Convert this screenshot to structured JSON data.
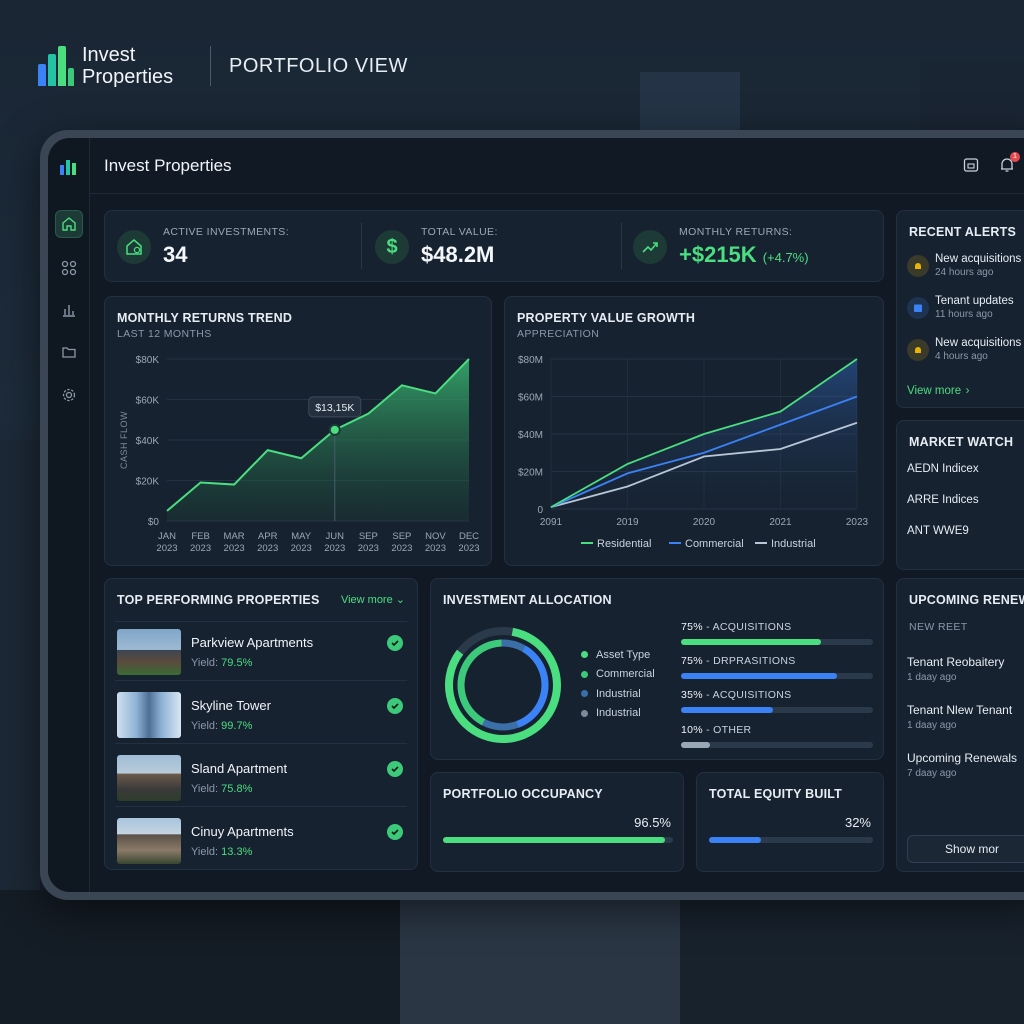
{
  "brand": {
    "title": "Invest Properties",
    "view": "PORTFOLIO VIEW"
  },
  "colors": {
    "accent_green": "#4ade80",
    "accent_blue": "#3b82f6",
    "muted": "#8a98a8",
    "bg_card": "#172230"
  },
  "topbar": {
    "title": "Invest Properties",
    "notification_count": "1"
  },
  "rail": {
    "icons": [
      "home-icon",
      "grid-icon",
      "bar-chart-icon",
      "folder-icon",
      "settings-icon"
    ]
  },
  "kpis": [
    {
      "label": "ACTIVE INVESTMENTS:",
      "value": "34",
      "icon": "house-icon"
    },
    {
      "label": "TOTAL VALUE:",
      "value": "$48.2M",
      "icon": "dollar-icon"
    },
    {
      "label": "MONTHLY RETURNS:",
      "value": "+$215K",
      "change": "(+4.7%)",
      "icon": "trend-up-icon"
    }
  ],
  "alerts": {
    "title": "RECENT ALERTS",
    "items": [
      {
        "title": "New acquisitions",
        "time": "24 hours ago",
        "icon": "bell-icon"
      },
      {
        "title": "Tenant updates",
        "time": "11 hours ago",
        "icon": "calendar-icon"
      },
      {
        "title": "New acquisitions",
        "time": "4 hours ago",
        "icon": "bell-icon"
      }
    ],
    "view_more": "View more"
  },
  "market_watch": {
    "title": "MARKET WATCH",
    "items": [
      "AEDN Indicex",
      "ARRE Indices",
      "ANT WWE9"
    ]
  },
  "returns_chart": {
    "title": "MONTHLY RETURNS TREND",
    "subtitle": "LAST 12 MONTHS",
    "tooltip": "$13,15K"
  },
  "growth_chart": {
    "title": "PROPERTY VALUE GROWTH",
    "subtitle": "APPRECIATION"
  },
  "chart_data": [
    {
      "type": "area",
      "title": "MONTHLY RETURNS TREND",
      "subtitle": "LAST 12 MONTHS",
      "ylabel": "CASH FLOW",
      "xlabel": "",
      "categories": [
        "JAN 2023",
        "FEB 2023",
        "MAR 2023",
        "APR 2023",
        "MAY 2023",
        "JUN 2023",
        "SEP 2023",
        "SEP 2023",
        "NOV 2023",
        "DEC 2023"
      ],
      "values": [
        5,
        19,
        18,
        35,
        31,
        45,
        53,
        67,
        63,
        80
      ],
      "yticks": [
        "$0",
        "$20K",
        "$40K",
        "$60K",
        "$80K"
      ],
      "ylim": [
        0,
        80
      ],
      "grid": true,
      "annotation": "$13,15K"
    },
    {
      "type": "line",
      "title": "PROPERTY VALUE GROWTH",
      "subtitle": "APPRECIATION",
      "xlabel": "",
      "ylabel": "",
      "x": [
        "2091",
        "2019",
        "2020",
        "2021",
        "2023"
      ],
      "yticks": [
        "0",
        "$20M",
        "$40M",
        "$60M",
        "$80M"
      ],
      "ylim": [
        0,
        80
      ],
      "series": [
        {
          "name": "Residential",
          "color": "#4ade80",
          "values": [
            1,
            24,
            40,
            52,
            80
          ]
        },
        {
          "name": "Commercial",
          "color": "#3b82f6",
          "values": [
            1,
            19,
            30,
            45,
            60
          ]
        },
        {
          "name": "Industrial",
          "color": "#b9c6d6",
          "values": [
            1,
            12,
            28,
            32,
            46
          ]
        }
      ],
      "legend": "bottom",
      "grid": true
    }
  ],
  "top_properties": {
    "title": "TOP PERFORMING PROPERTIES",
    "view_more": "View more",
    "yield_label": "Yield:",
    "items": [
      {
        "name": "Parkview Apartments",
        "yield": "79.5%"
      },
      {
        "name": "Skyline Tower",
        "yield": "99.7%"
      },
      {
        "name": "Sland Apartment",
        "yield": "75.8%"
      },
      {
        "name": "Cinuy Apartments",
        "yield": "13.3%"
      }
    ]
  },
  "allocation": {
    "title": "INVESTMENT ALLOCATION",
    "legend": [
      {
        "label": "Asset Type",
        "color": "#4ade80"
      },
      {
        "label": "Commercial",
        "color": "#3dc97a"
      },
      {
        "label": "Industrial",
        "color": "#3b6fa8"
      },
      {
        "label": "Industrial",
        "color": "#7d8a99"
      }
    ],
    "bars": [
      {
        "pct": "75%",
        "label": " - ACQUISITIONS",
        "fraction": 0.73,
        "color": "#4ade80"
      },
      {
        "pct": "75%",
        "label": " - DRPRASITIONS",
        "fraction": 0.81,
        "color": "#3b82f6"
      },
      {
        "pct": "35%",
        "label": " - ACQUISITIONS",
        "fraction": 0.48,
        "color": "#3b82f6"
      },
      {
        "pct": "10%",
        "label": " - OTHER",
        "fraction": 0.15,
        "color": "#9aa8b6"
      }
    ]
  },
  "occupancy": {
    "title": "PORTFOLIO OCCUPANCY",
    "value": "96.5%",
    "fraction": 0.965
  },
  "equity": {
    "title": "TOTAL EQUITY BUILT",
    "value": "32%",
    "fraction": 0.32
  },
  "renewals": {
    "title": "UPCOMING RENEWA",
    "subtitle": "NEW REET",
    "items": [
      {
        "title": "Tenant Reobaitery",
        "time": "1 daay ago"
      },
      {
        "title": "Tenant Nlew Tenant",
        "time": "1 daay ago"
      },
      {
        "title": "Upcoming Renewals",
        "time": "7 daay ago"
      }
    ],
    "button": "Show mor"
  }
}
